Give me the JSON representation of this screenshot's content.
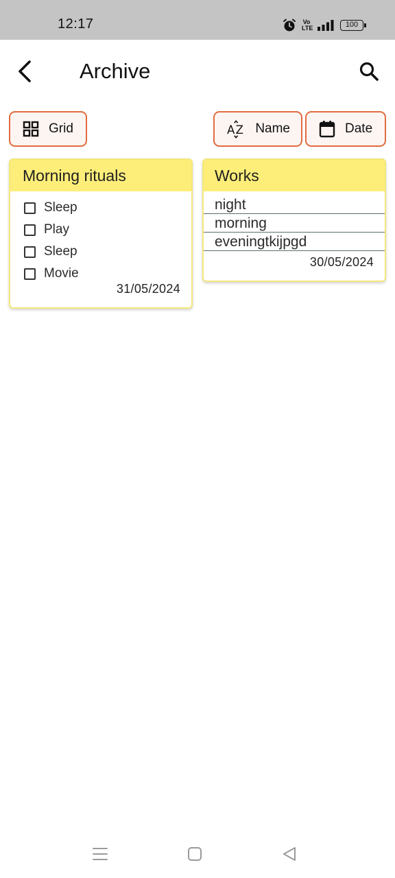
{
  "status_bar": {
    "time": "12:17",
    "volte_line1": "Vo",
    "volte_line2": "LTE",
    "battery": "100",
    "icons": [
      "alarm-icon",
      "volte-icon",
      "signal-icon",
      "battery-icon"
    ]
  },
  "app_bar": {
    "title": "Archive",
    "back_icon": "arrow-back-icon",
    "search_icon": "search-icon"
  },
  "toolbar": {
    "grid_label": "Grid",
    "name_label": "Name",
    "date_label": "Date",
    "accent_color": "#e06b3f"
  },
  "notes": [
    {
      "title": "Morning rituals",
      "type": "checklist",
      "items": [
        {
          "label": "Sleep",
          "checked": false
        },
        {
          "label": "Play",
          "checked": false
        },
        {
          "label": "Sleep",
          "checked": false
        },
        {
          "label": "Movie",
          "checked": false
        }
      ],
      "date": "31/05/2024",
      "color": "#fdee7a"
    },
    {
      "title": "Works",
      "type": "text",
      "lines": [
        "night",
        "morning",
        "eveningtkijpgd"
      ],
      "date": "30/05/2024",
      "color": "#fdee7a"
    }
  ],
  "nav_bar": {
    "icons": [
      "menu-icon",
      "home-icon",
      "back-triangle-icon"
    ]
  }
}
